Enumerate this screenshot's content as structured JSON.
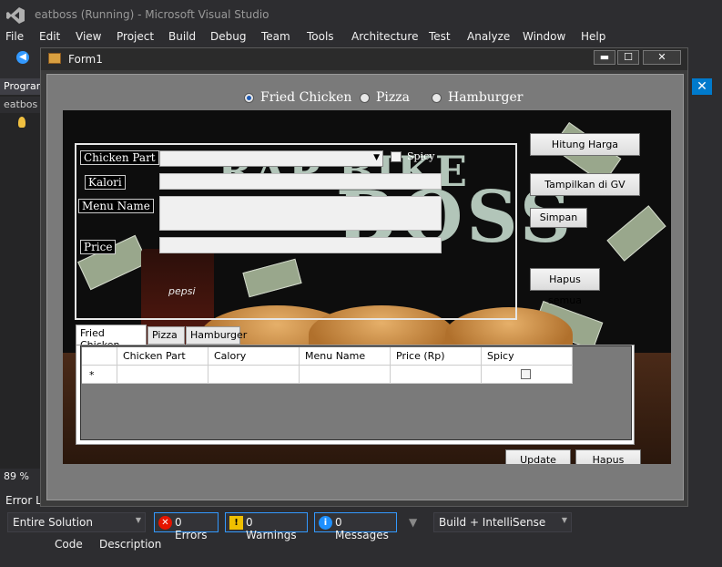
{
  "vs": {
    "title": "eatboss (Running) - Microsoft Visual Studio",
    "menu": [
      "File",
      "Edit",
      "View",
      "Project",
      "Build",
      "Debug",
      "Team",
      "Tools",
      "Architecture",
      "Test",
      "Analyze",
      "Window",
      "Help"
    ],
    "left_tab": "Program",
    "left_item": "eatbos",
    "zoom": "89 %",
    "error_list_title": "Error List",
    "scope": "Entire Solution",
    "errors": "0 Errors",
    "warnings": "0 Warnings",
    "messages": "0 Messages",
    "build_filter": "Build + IntelliSense",
    "columns": [
      "Code",
      "Description"
    ]
  },
  "form": {
    "title": "Form1",
    "radios": [
      {
        "label": "Fried Chicken",
        "checked": true
      },
      {
        "label": "Pizza",
        "checked": false
      },
      {
        "label": "Hamburger",
        "checked": false
      }
    ],
    "fields": {
      "chicken_part": "Chicken Part",
      "kalori": "Kalori",
      "menu_name": "Menu Name",
      "price": "Price",
      "spicy": "Spicy"
    },
    "buttons": {
      "hitung": "Hitung Harga",
      "tampilkan": "Tampilkan di GV",
      "simpan": "Simpan",
      "hapus_semua": "Hapus semua",
      "update": "Update",
      "hapus": "Hapus"
    },
    "tabs": [
      "Fried Chicken",
      "Pizza",
      "Hamburger"
    ],
    "grid": {
      "columns": [
        "Chicken Part",
        "Calory",
        "Menu Name",
        "Price (Rp)",
        "Spicy"
      ],
      "new_row_marker": "*"
    },
    "bg_text": {
      "line1": "RAP BIKE",
      "line2": "BOSS",
      "cup": "pepsi"
    }
  }
}
